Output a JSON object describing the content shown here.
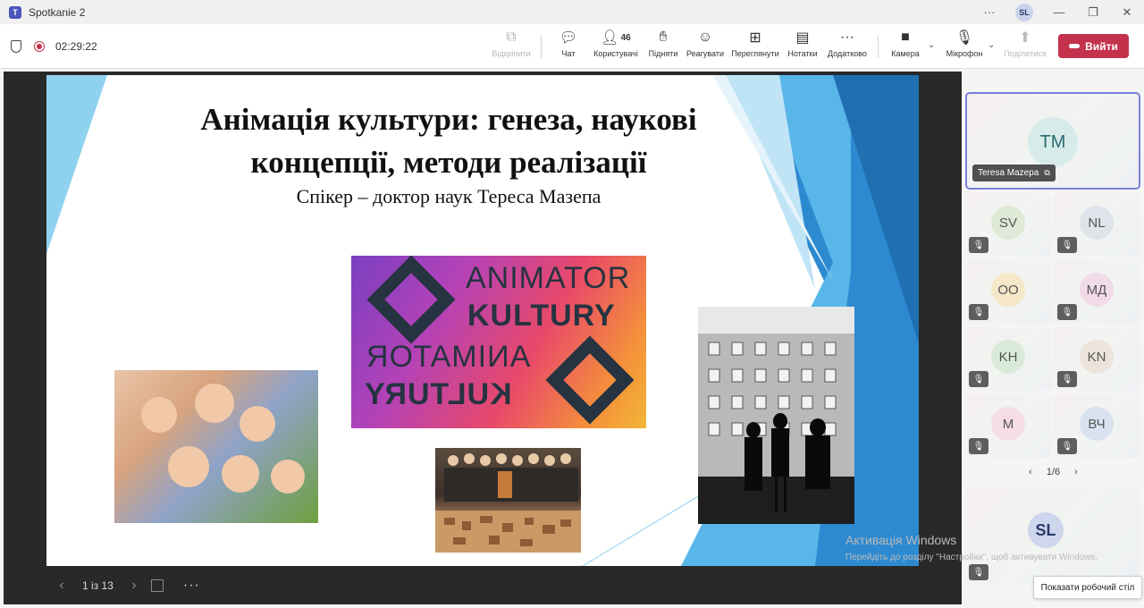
{
  "window": {
    "title": "Spotkanie 2",
    "user_initials": "SL"
  },
  "toolbar": {
    "timer": "02:29:22",
    "unpin": "Відкріпити",
    "chat": "Чат",
    "people": "Користувачі",
    "people_count": "46",
    "raise": "Підняти",
    "react": "Реагувати",
    "view": "Переглянути",
    "notes": "Нотатки",
    "more": "Додатково",
    "camera": "Камера",
    "mic": "Мікрофон",
    "share": "Поділитися",
    "leave": "Вийти"
  },
  "slide": {
    "title_line1": "Анімація культури: генеза, наукові",
    "title_line2": "концепції, методи реалізації",
    "subtitle": "Спікер – доктор наук Тереса Мазепа",
    "logo_line1": "ANIMATOR",
    "logo_line2": "KULTURY",
    "logo_line3": "ANIMATOR",
    "logo_line4": "KULTURY"
  },
  "slide_nav": {
    "counter": "1 із 13"
  },
  "participants": {
    "spotlight": {
      "initials": "TM",
      "name": "Teresa Mazepa"
    },
    "grid": [
      {
        "initials": "SV",
        "color": "#dfe9d7"
      },
      {
        "initials": "NL",
        "color": "#dfe3ea"
      },
      {
        "initials": "OO",
        "color": "#f6e7c8"
      },
      {
        "initials": "МД",
        "color": "#f0dbe6"
      },
      {
        "initials": "KH",
        "color": "#d9ebd8"
      },
      {
        "initials": "KN",
        "color": "#ece3da"
      },
      {
        "initials": "М",
        "color": "#f5dde3"
      },
      {
        "initials": "ВЧ",
        "color": "#d9e2f1"
      }
    ],
    "page": "1/6",
    "self": {
      "initials": "SL"
    }
  },
  "watermark": {
    "title": "Активація Windows",
    "body": "Перейдіть до розділу \"Настройки\", щоб активувати Windows."
  },
  "tooltip": "Показати робочий стіл"
}
